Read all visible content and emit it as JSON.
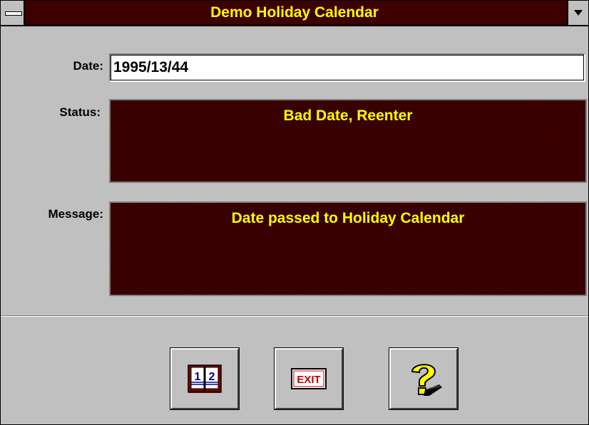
{
  "window": {
    "title": "Demo Holiday Calendar"
  },
  "form": {
    "date_label": "Date:",
    "date_value": "1995/13/44",
    "status_label": "Status:",
    "status_text": "Bad Date, Reenter",
    "message_label": "Message:",
    "message_text": "Date passed to Holiday Calendar"
  },
  "buttons": {
    "exit_label": "EXIT",
    "calendar_icon_digits": [
      "1",
      "2"
    ]
  },
  "colors": {
    "titlebar_bg": "#3c0000",
    "title_text": "#ffff00",
    "panel_bg": "#3c0000",
    "panel_text": "#ffff00",
    "window_bg": "#c0c0c0"
  },
  "icons": {
    "system_menu": "system-menu-icon",
    "dropdown": "chevron-down-icon",
    "calendar": "calendar-book-icon",
    "exit": "exit-sign-icon",
    "help": "help-question-icon"
  }
}
